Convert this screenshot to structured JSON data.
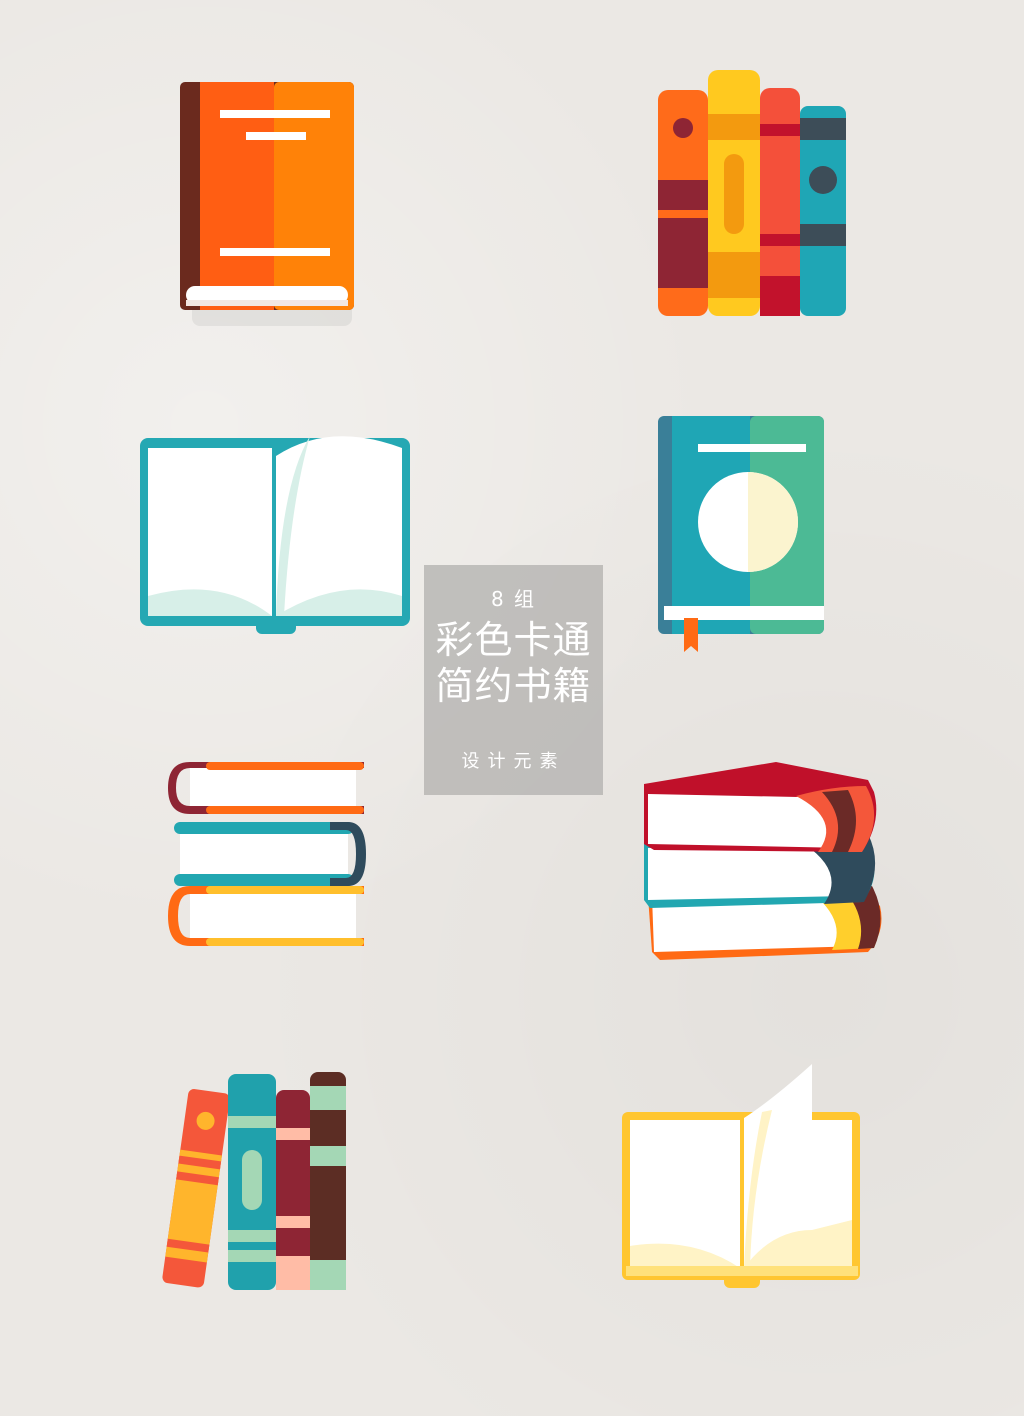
{
  "poster": {
    "count_label": "8 组",
    "title_line1": "彩色卡通",
    "title_line2": "简约书籍",
    "subtitle": "设计元素"
  },
  "icons": [
    {
      "name": "orange-book-icon",
      "colors": [
        "#ff5e13",
        "#ff8208",
        "#6b2a1e"
      ]
    },
    {
      "name": "standing-books-icon",
      "colors": [
        "#ff6b1a",
        "#ffc91f",
        "#f4503a",
        "#1fa6b5"
      ]
    },
    {
      "name": "open-book-teal-icon",
      "colors": [
        "#25a8b3",
        "#d7efe8"
      ]
    },
    {
      "name": "teal-green-book-icon",
      "colors": [
        "#1fa6b5",
        "#4cba95",
        "#fbf4cf"
      ]
    },
    {
      "name": "stacked-books-flat-icon",
      "colors": [
        "#8e2534",
        "#ff6a14",
        "#22a7b1",
        "#2f4b5c",
        "#ffbf2c"
      ]
    },
    {
      "name": "stacked-books-angled-icon",
      "colors": [
        "#c0102a",
        "#f4573a",
        "#6b2a27",
        "#2f4b5c",
        "#ffcf2c"
      ]
    },
    {
      "name": "leaning-books-icon",
      "colors": [
        "#f4573a",
        "#ffb52c",
        "#20a1ac",
        "#8e2534",
        "#5c2d24",
        "#a4d7b5"
      ]
    },
    {
      "name": "open-book-yellow-icon",
      "colors": [
        "#ffc630",
        "#fff3c6"
      ]
    }
  ]
}
